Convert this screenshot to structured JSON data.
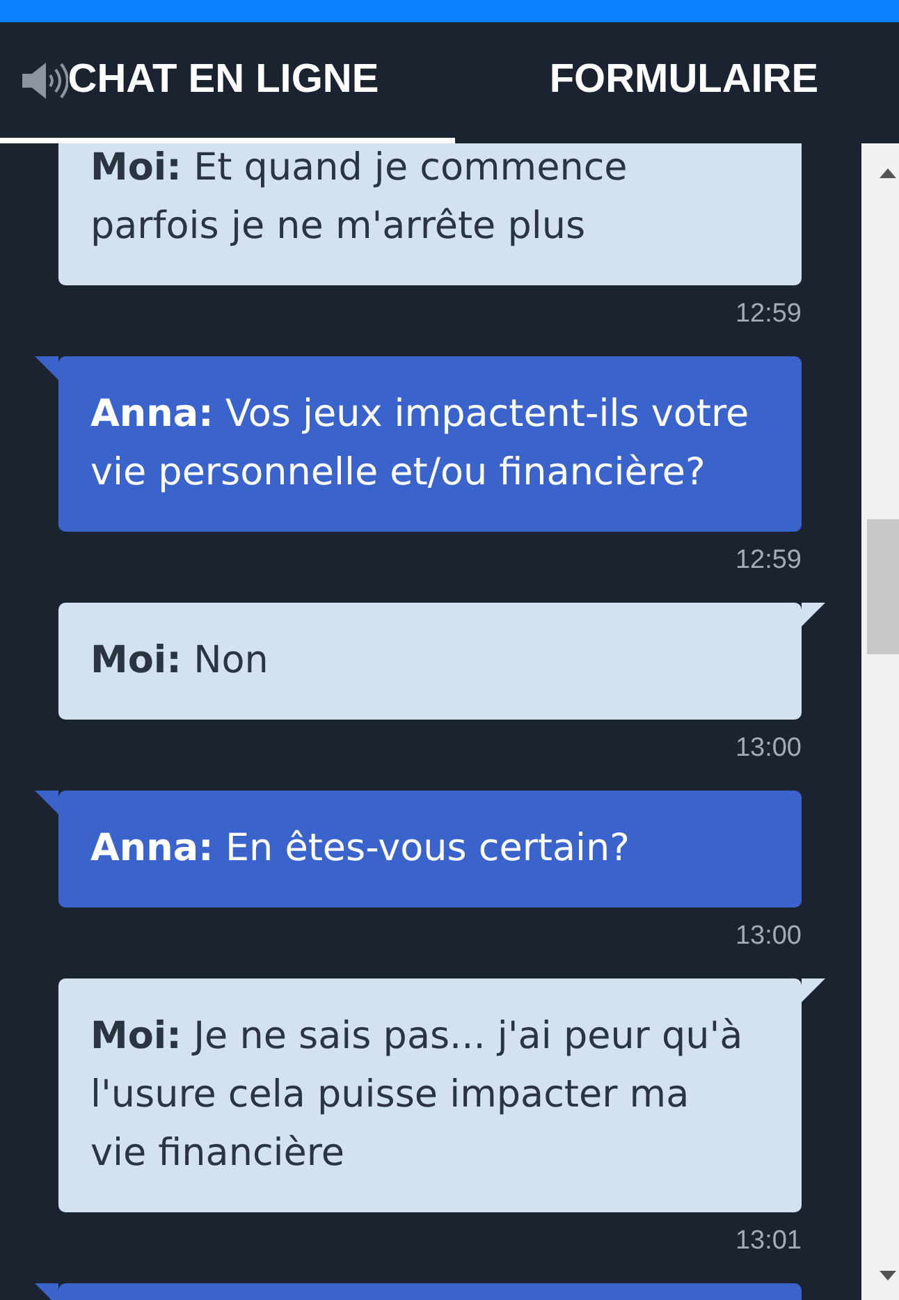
{
  "tabs": [
    {
      "kind": "chat",
      "label": "CHAT EN LIGNE",
      "selected": true
    },
    {
      "kind": "form",
      "label": "FORMULAIRE",
      "selected": false
    }
  ],
  "messages": [
    {
      "kind": "user",
      "sender": "Moi:",
      "lines": [
        "Et quand je commence",
        "parfois je ne m'arrête plus"
      ],
      "time": "12:59"
    },
    {
      "kind": "agent",
      "sender": "Anna:",
      "lines": [
        "Vos jeux impactent-ils votre",
        "vie personnelle et/ou financière?"
      ],
      "time": "12:59"
    },
    {
      "kind": "user",
      "sender": "Moi:",
      "lines": [
        "Non"
      ],
      "time": "13:00"
    },
    {
      "kind": "agent",
      "sender": "Anna:",
      "lines": [
        "En êtes-vous certain?"
      ],
      "time": "13:00"
    },
    {
      "kind": "user",
      "sender": "Moi:",
      "lines": [
        "Je ne sais pas... j'ai peur qu'à",
        "l'usure cela puisse impacter ma",
        "vie financière"
      ],
      "time": "13:01"
    },
    {
      "kind": "agent"
    }
  ]
}
